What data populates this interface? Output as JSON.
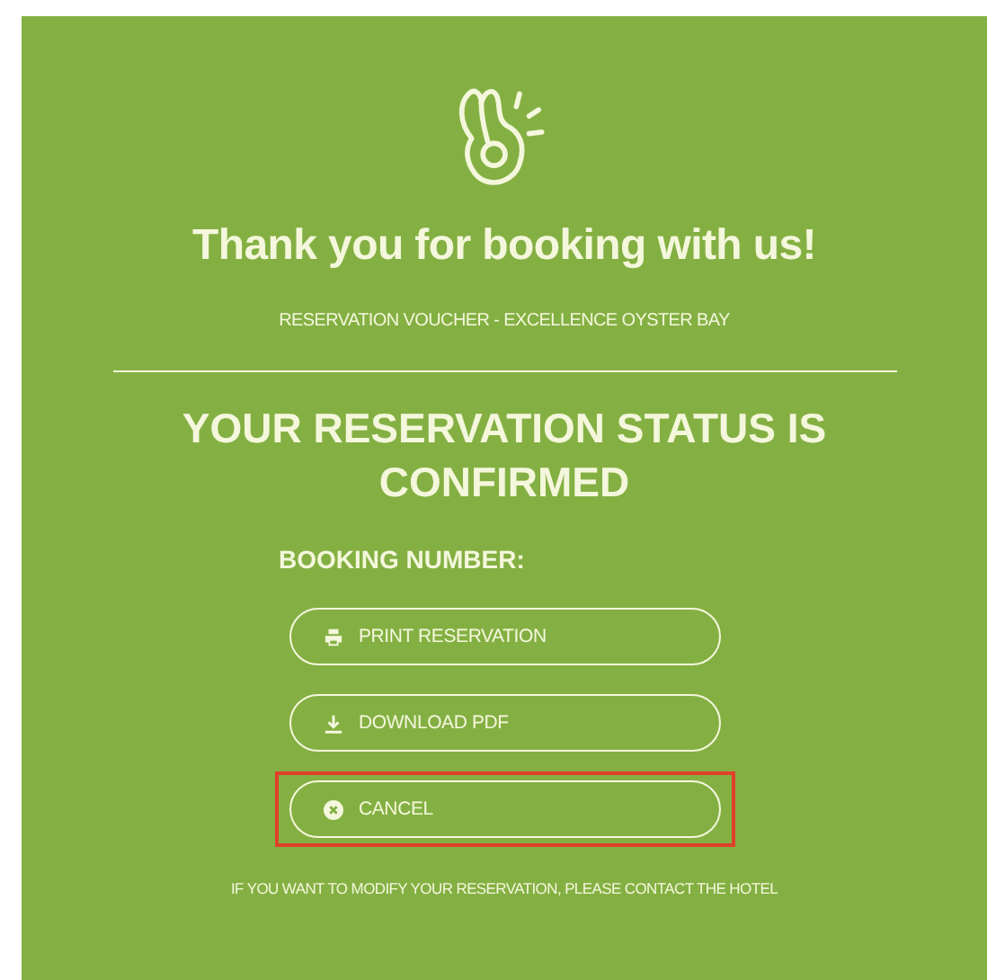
{
  "title": "Thank you for booking with us!",
  "subtitle": "RESERVATION VOUCHER - EXCELLENCE OYSTER BAY",
  "status_heading": "YOUR RESERVATION STATUS IS CONFIRMED",
  "booking_number_label": "BOOKING NUMBER:",
  "buttons": [
    {
      "kind": "print",
      "label": "PRINT RESERVATION",
      "highlighted": false
    },
    {
      "kind": "download",
      "label": "DOWNLOAD PDF",
      "highlighted": false
    },
    {
      "kind": "cancel",
      "label": "CANCEL",
      "highlighted": true
    }
  ],
  "footer_note": "IF YOU WANT TO MODIFY YOUR RESERVATION, PLEASE CONTACT THE HOTEL"
}
